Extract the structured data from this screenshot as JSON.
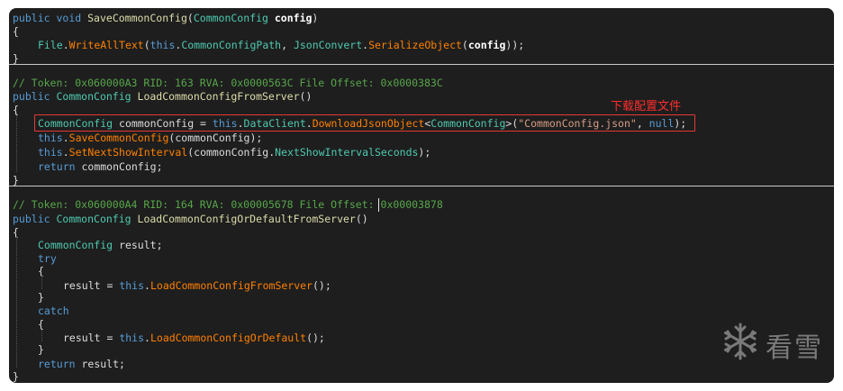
{
  "code": {
    "block1": {
      "sig_public": "public",
      "sig_void": "void",
      "sig_method": "SaveCommonConfig",
      "sig_paramtype": "CommonConfig",
      "sig_param": "config",
      "open": "{",
      "b_file": "File",
      "b_write": "WriteAllText",
      "b_this": "this",
      "b_path": "CommonConfigPath",
      "b_json": "JsonConvert",
      "b_ser": "SerializeObject",
      "b_config": "config",
      "close": "}"
    },
    "block2": {
      "comment": "// Token: 0x060000A3 RID: 163 RVA: 0x0000563C File Offset: 0x0000383C",
      "sig_public": "public",
      "sig_type": "CommonConfig",
      "sig_method": "LoadCommonConfigFromServer",
      "open": "{",
      "l1_type": "CommonConfig",
      "l1_var": "commonConfig",
      "l1_this": "this",
      "l1_client": "DataClient",
      "l1_download": "DownloadJsonObject",
      "l1_generic": "CommonConfig",
      "l1_string": "\"CommonConfig.json\"",
      "l1_null": "null",
      "l2_this": "this",
      "l2_method": "SaveCommonConfig",
      "l2_arg": "commonConfig",
      "l3_this": "this",
      "l3_method": "SetNextShowInterval",
      "l3_arg": "commonConfig",
      "l3_prop": "NextShowIntervalSeconds",
      "l4_return": "return",
      "l4_var": "commonConfig",
      "close": "}"
    },
    "block3": {
      "comment_a": "// Token: 0x060000A4 RID: 164 RVA: 0x00005678 File Offset:",
      "comment_b": "0x00003878",
      "sig_public": "public",
      "sig_type": "CommonConfig",
      "sig_method": "LoadCommonConfigOrDefaultFromServer",
      "open": "{",
      "decl_type": "CommonConfig",
      "decl_var": "result",
      "try_kw": "try",
      "try_open": "{",
      "try_result": "result",
      "try_this": "this",
      "try_method": "LoadCommonConfigFromServer",
      "try_close": "}",
      "catch_kw": "catch",
      "catch_open": "{",
      "catch_result": "result",
      "catch_this": "this",
      "catch_method": "LoadCommonConfigOrDefault",
      "catch_close": "}",
      "ret_kw": "return",
      "ret_var": "result",
      "close": "}"
    }
  },
  "annotation": {
    "text": "下载配置文件",
    "color": "#ff2d2d"
  },
  "watermark": {
    "text": "看雪",
    "icon": "snowflake-icon"
  },
  "colors": {
    "background": "#1e1e1e",
    "keyword": "#569cd6",
    "type": "#4ec9b0",
    "method": "#dcdcaa",
    "framework_method": "#ff8000",
    "comment": "#57a64a",
    "string": "#d69d85",
    "highlight_border": "#e53935"
  }
}
